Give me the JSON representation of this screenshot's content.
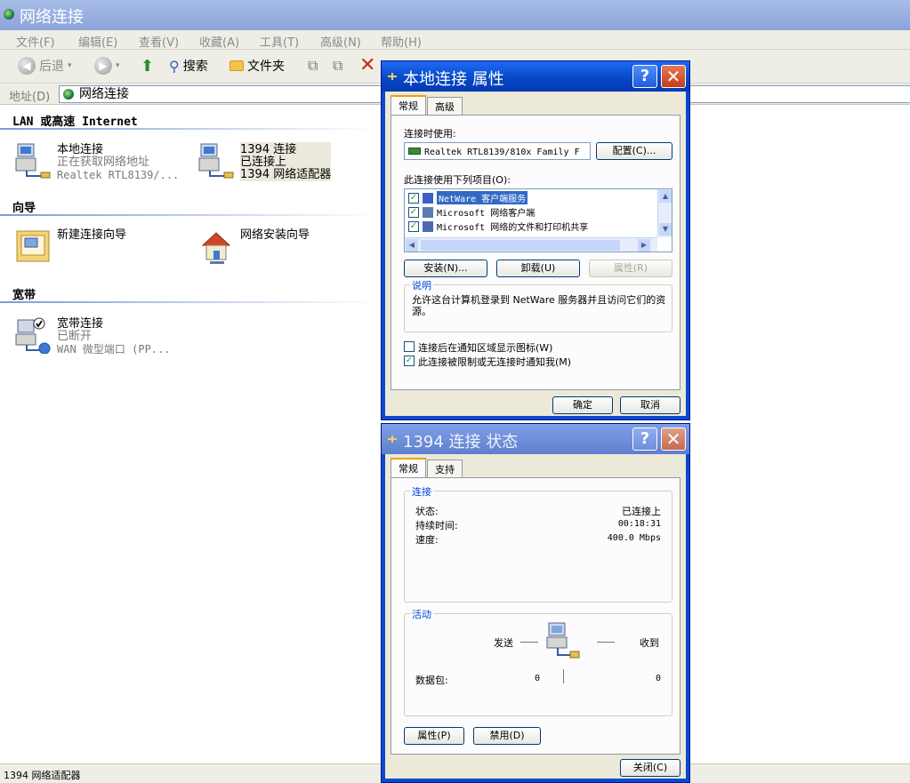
{
  "window": {
    "title": "网络连接"
  },
  "menu": [
    "文件(F)",
    "编辑(E)",
    "查看(V)",
    "收藏(A)",
    "工具(T)",
    "高级(N)",
    "帮助(H)"
  ],
  "toolbar": {
    "back": "后退",
    "search": "搜索",
    "folders": "文件夹"
  },
  "address": {
    "label": "地址(D)",
    "value": "网络连接"
  },
  "sections": {
    "lan": "LAN 或高速 Internet",
    "wizard": "向导",
    "broadband": "宽带"
  },
  "lan_items": [
    {
      "name": "本地连接",
      "status": "正在获取网络地址",
      "device": "Realtek RTL8139/..."
    },
    {
      "name": "1394 连接",
      "status": "已连接上",
      "device": "1394 网络适配器"
    }
  ],
  "wizard_items": [
    "新建连接向导",
    "网络安装向导"
  ],
  "broadband_items": [
    {
      "name": "宽带连接",
      "status": "已断开",
      "device": "WAN 微型端口 (PP..."
    }
  ],
  "statusbar": "1394 网络适配器",
  "props_dialog": {
    "title": "本地连接 属性",
    "tabs": [
      "常规",
      "高级"
    ],
    "connect_using_label": "连接时使用:",
    "adapter": "Realtek RTL8139/810x Family F",
    "configure_button": "配置(C)...",
    "items_label": "此连接使用下列项目(O):",
    "items": [
      "NetWare 客户端服务",
      "Microsoft 网络客户端",
      "Microsoft 网络的文件和打印机共享"
    ],
    "install_button": "安装(N)...",
    "uninstall_button": "卸载(U)",
    "properties_button": "属性(R)",
    "description_label": "说明",
    "description": "允许这台计算机登录到 NetWare 服务器并且访问它们的资源。",
    "checkbox1": "连接后在通知区域显示图标(W)",
    "checkbox2": "此连接被限制或无连接时通知我(M)",
    "checkbox1_checked": false,
    "checkbox2_checked": true,
    "ok_button": "确定",
    "cancel_button": "取消"
  },
  "status_dialog": {
    "title": "1394 连接 状态",
    "tabs": [
      "常规",
      "支持"
    ],
    "connection_label": "连接",
    "state_label": "状态:",
    "state_value": "已连接上",
    "duration_label": "持续时间:",
    "duration_value": "00:18:31",
    "speed_label": "速度:",
    "speed_value": "400.0 Mbps",
    "activity_label": "活动",
    "sent_label": "发送",
    "received_label": "收到",
    "packets_label": "数据包:",
    "packets_sent": "0",
    "packets_received": "0",
    "properties_button": "属性(P)",
    "disable_button": "禁用(D)",
    "close_button": "关闭(C)"
  },
  "colors": {
    "xp_blue": "#0a4ad0",
    "close_red": "#c43c1a",
    "window_bg": "#ece9d8"
  }
}
